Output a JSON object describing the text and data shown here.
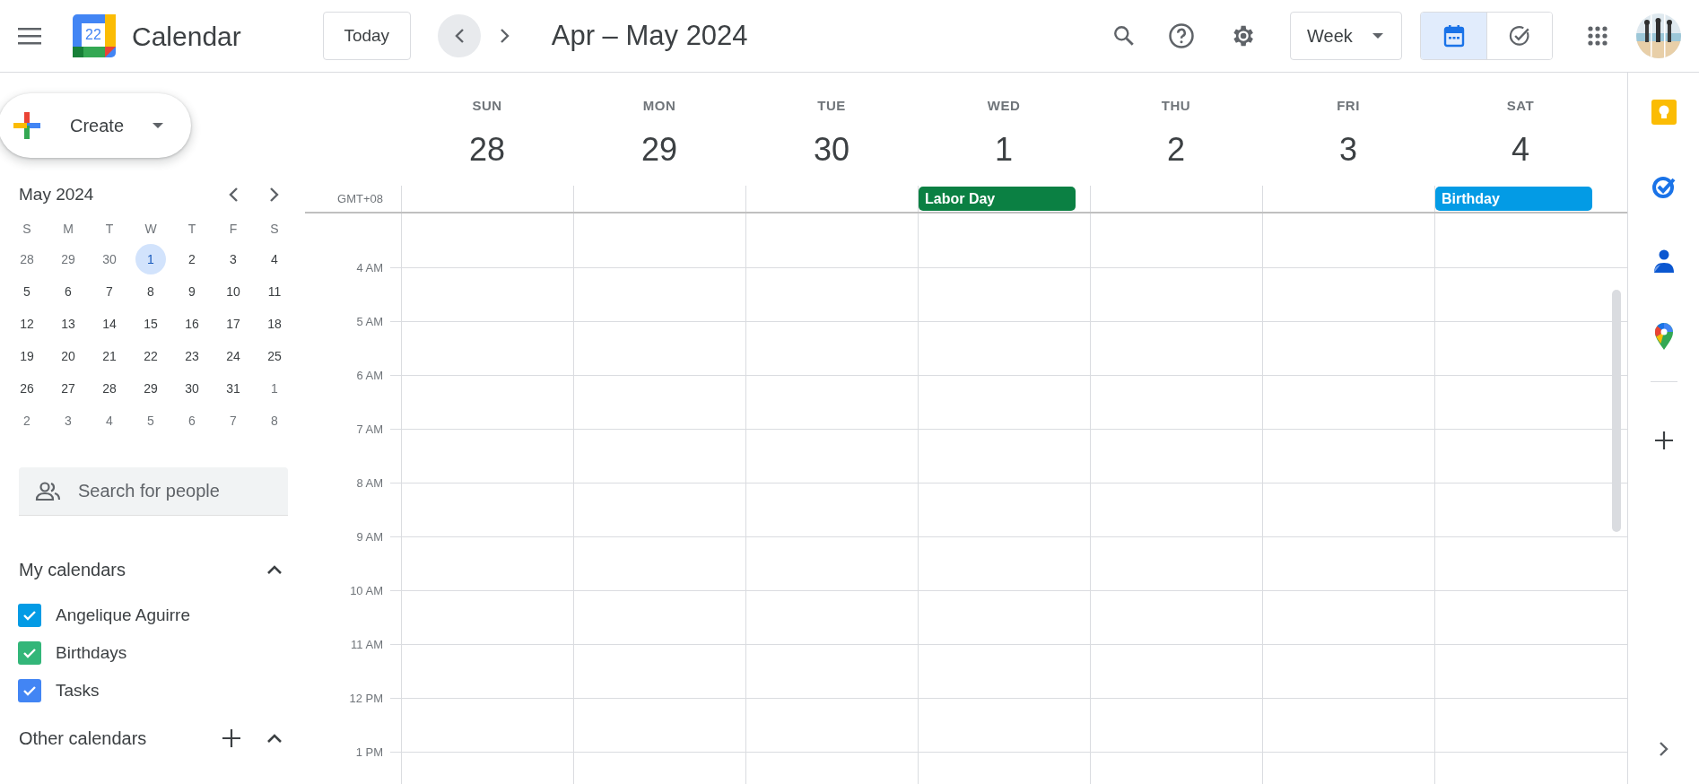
{
  "app": {
    "title": "Calendar",
    "logo_date": "22"
  },
  "toolbar": {
    "today": "Today",
    "range": "Apr – May 2024",
    "view": "Week",
    "modes": [
      {
        "kind": "calendar",
        "selected": true
      },
      {
        "kind": "tasks",
        "selected": false
      }
    ]
  },
  "create": {
    "label": "Create"
  },
  "mini_calendar": {
    "title": "May 2024",
    "weekdays": [
      "S",
      "M",
      "T",
      "W",
      "T",
      "F",
      "S"
    ],
    "weeks": [
      [
        {
          "day": "28",
          "other_month": true,
          "selected": false
        },
        {
          "day": "29",
          "other_month": true,
          "selected": false
        },
        {
          "day": "30",
          "other_month": true,
          "selected": false
        },
        {
          "day": "1",
          "other_month": false,
          "selected": true
        },
        {
          "day": "2",
          "other_month": false,
          "selected": false
        },
        {
          "day": "3",
          "other_month": false,
          "selected": false
        },
        {
          "day": "4",
          "other_month": false,
          "selected": false
        }
      ],
      [
        {
          "day": "5",
          "other_month": false,
          "selected": false
        },
        {
          "day": "6",
          "other_month": false,
          "selected": false
        },
        {
          "day": "7",
          "other_month": false,
          "selected": false
        },
        {
          "day": "8",
          "other_month": false,
          "selected": false
        },
        {
          "day": "9",
          "other_month": false,
          "selected": false
        },
        {
          "day": "10",
          "other_month": false,
          "selected": false
        },
        {
          "day": "11",
          "other_month": false,
          "selected": false
        }
      ],
      [
        {
          "day": "12",
          "other_month": false,
          "selected": false
        },
        {
          "day": "13",
          "other_month": false,
          "selected": false
        },
        {
          "day": "14",
          "other_month": false,
          "selected": false
        },
        {
          "day": "15",
          "other_month": false,
          "selected": false
        },
        {
          "day": "16",
          "other_month": false,
          "selected": false
        },
        {
          "day": "17",
          "other_month": false,
          "selected": false
        },
        {
          "day": "18",
          "other_month": false,
          "selected": false
        }
      ],
      [
        {
          "day": "19",
          "other_month": false,
          "selected": false
        },
        {
          "day": "20",
          "other_month": false,
          "selected": false
        },
        {
          "day": "21",
          "other_month": false,
          "selected": false
        },
        {
          "day": "22",
          "other_month": false,
          "selected": false
        },
        {
          "day": "23",
          "other_month": false,
          "selected": false
        },
        {
          "day": "24",
          "other_month": false,
          "selected": false
        },
        {
          "day": "25",
          "other_month": false,
          "selected": false
        }
      ],
      [
        {
          "day": "26",
          "other_month": false,
          "selected": false
        },
        {
          "day": "27",
          "other_month": false,
          "selected": false
        },
        {
          "day": "28",
          "other_month": false,
          "selected": false
        },
        {
          "day": "29",
          "other_month": false,
          "selected": false
        },
        {
          "day": "30",
          "other_month": false,
          "selected": false
        },
        {
          "day": "31",
          "other_month": false,
          "selected": false
        },
        {
          "day": "1",
          "other_month": true,
          "selected": false
        }
      ],
      [
        {
          "day": "2",
          "other_month": true,
          "selected": false
        },
        {
          "day": "3",
          "other_month": true,
          "selected": false
        },
        {
          "day": "4",
          "other_month": true,
          "selected": false
        },
        {
          "day": "5",
          "other_month": true,
          "selected": false
        },
        {
          "day": "6",
          "other_month": true,
          "selected": false
        },
        {
          "day": "7",
          "other_month": true,
          "selected": false
        },
        {
          "day": "8",
          "other_month": true,
          "selected": false
        }
      ]
    ]
  },
  "people_search": {
    "placeholder": "Search for people"
  },
  "my_calendars": {
    "title": "My calendars",
    "expanded": true,
    "items": [
      {
        "name": "Angelique Aguirre",
        "checked": true,
        "color": "#039be5"
      },
      {
        "name": "Birthdays",
        "checked": true,
        "color": "#33b679"
      },
      {
        "name": "Tasks",
        "checked": true,
        "color": "#4285f4"
      }
    ]
  },
  "other_calendars": {
    "title": "Other calendars",
    "expanded": true
  },
  "week": {
    "timezone": "GMT+08",
    "days": [
      {
        "weekday": "SUN",
        "date": "28"
      },
      {
        "weekday": "MON",
        "date": "29"
      },
      {
        "weekday": "TUE",
        "date": "30"
      },
      {
        "weekday": "WED",
        "date": "1",
        "events": [
          {
            "title": "Labor Day",
            "color": "#0b8043"
          }
        ]
      },
      {
        "weekday": "THU",
        "date": "2"
      },
      {
        "weekday": "FRI",
        "date": "3"
      },
      {
        "weekday": "SAT",
        "date": "4",
        "events": [
          {
            "title": "Birthday",
            "color": "#039be5"
          }
        ]
      }
    ],
    "hours": [
      "4 AM",
      "5 AM",
      "6 AM",
      "7 AM",
      "8 AM",
      "9 AM",
      "10 AM",
      "11 AM",
      "12 PM",
      "1 PM"
    ]
  }
}
